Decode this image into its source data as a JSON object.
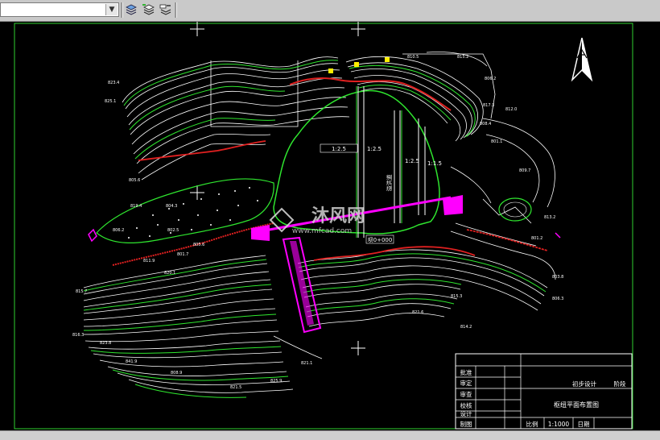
{
  "toolbar": {
    "layer_value": "",
    "icons": [
      "layer-manager-icon",
      "layer-previous-icon",
      "layer-state-icon"
    ]
  },
  "drawing": {
    "title_block": {
      "rows_left": [
        "批准",
        "审定",
        "审查",
        "校核",
        "设计",
        "制图"
      ],
      "stage_label": "初步设计",
      "stage_value": "阶段",
      "drawing_name": "枢纽平面布置图",
      "scale_label": "比例",
      "scale_value": "1:1000",
      "date_label": "日期"
    },
    "watermark": {
      "brand": "沐风网",
      "url": "www.mfcad.com"
    },
    "dam_label": "坝0+000",
    "spillway_labels": [
      "1:2.5",
      "1:2.5",
      "溢洪道",
      "1:2.5",
      "1:1.5"
    ],
    "elevations": [
      "823.4",
      "825.1",
      "810.5",
      "815.2",
      "806.2",
      "817.3",
      "808.4",
      "812.0",
      "801.1",
      "809.7",
      "813.2",
      "801.2",
      "805.6",
      "819.4",
      "806.2",
      "804.3",
      "802.5",
      "805.6",
      "801.7",
      "811.9",
      "820.1",
      "815.7",
      "816.3",
      "823.8",
      "841.9",
      "808.9",
      "821.5",
      "825.9",
      "815.3",
      "821.6",
      "803.8",
      "806.3",
      "814.2",
      "821.1"
    ],
    "north_arrow": "north-arrow"
  },
  "colors": {
    "background": "#000000",
    "contour_white": "#ffffff",
    "contour_green": "#2fe62f",
    "axis_magenta": "#ff00ff",
    "slope_red": "#e02020",
    "note_yellow": "#ffee00",
    "frame_green": "#30d030"
  }
}
